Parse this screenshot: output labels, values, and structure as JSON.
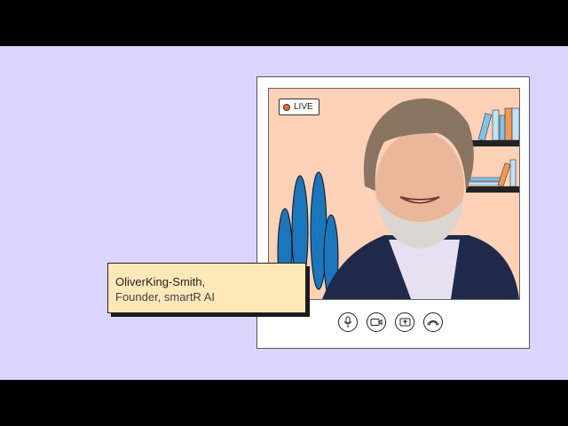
{
  "live_badge": {
    "label": "LIVE",
    "dot_color": "#f26b1d"
  },
  "speaker": {
    "name": "OliverKing-Smith,",
    "title": "Founder, smartR AI"
  },
  "controls": [
    {
      "icon": "microphone-icon"
    },
    {
      "icon": "video-camera-icon"
    },
    {
      "icon": "share-screen-icon"
    },
    {
      "icon": "hang-up-icon"
    }
  ],
  "colors": {
    "background": "#dcd5fb",
    "video_bg": "#ffd1b6",
    "name_card": "#ffe8b8",
    "plant": "#1a76bd"
  }
}
